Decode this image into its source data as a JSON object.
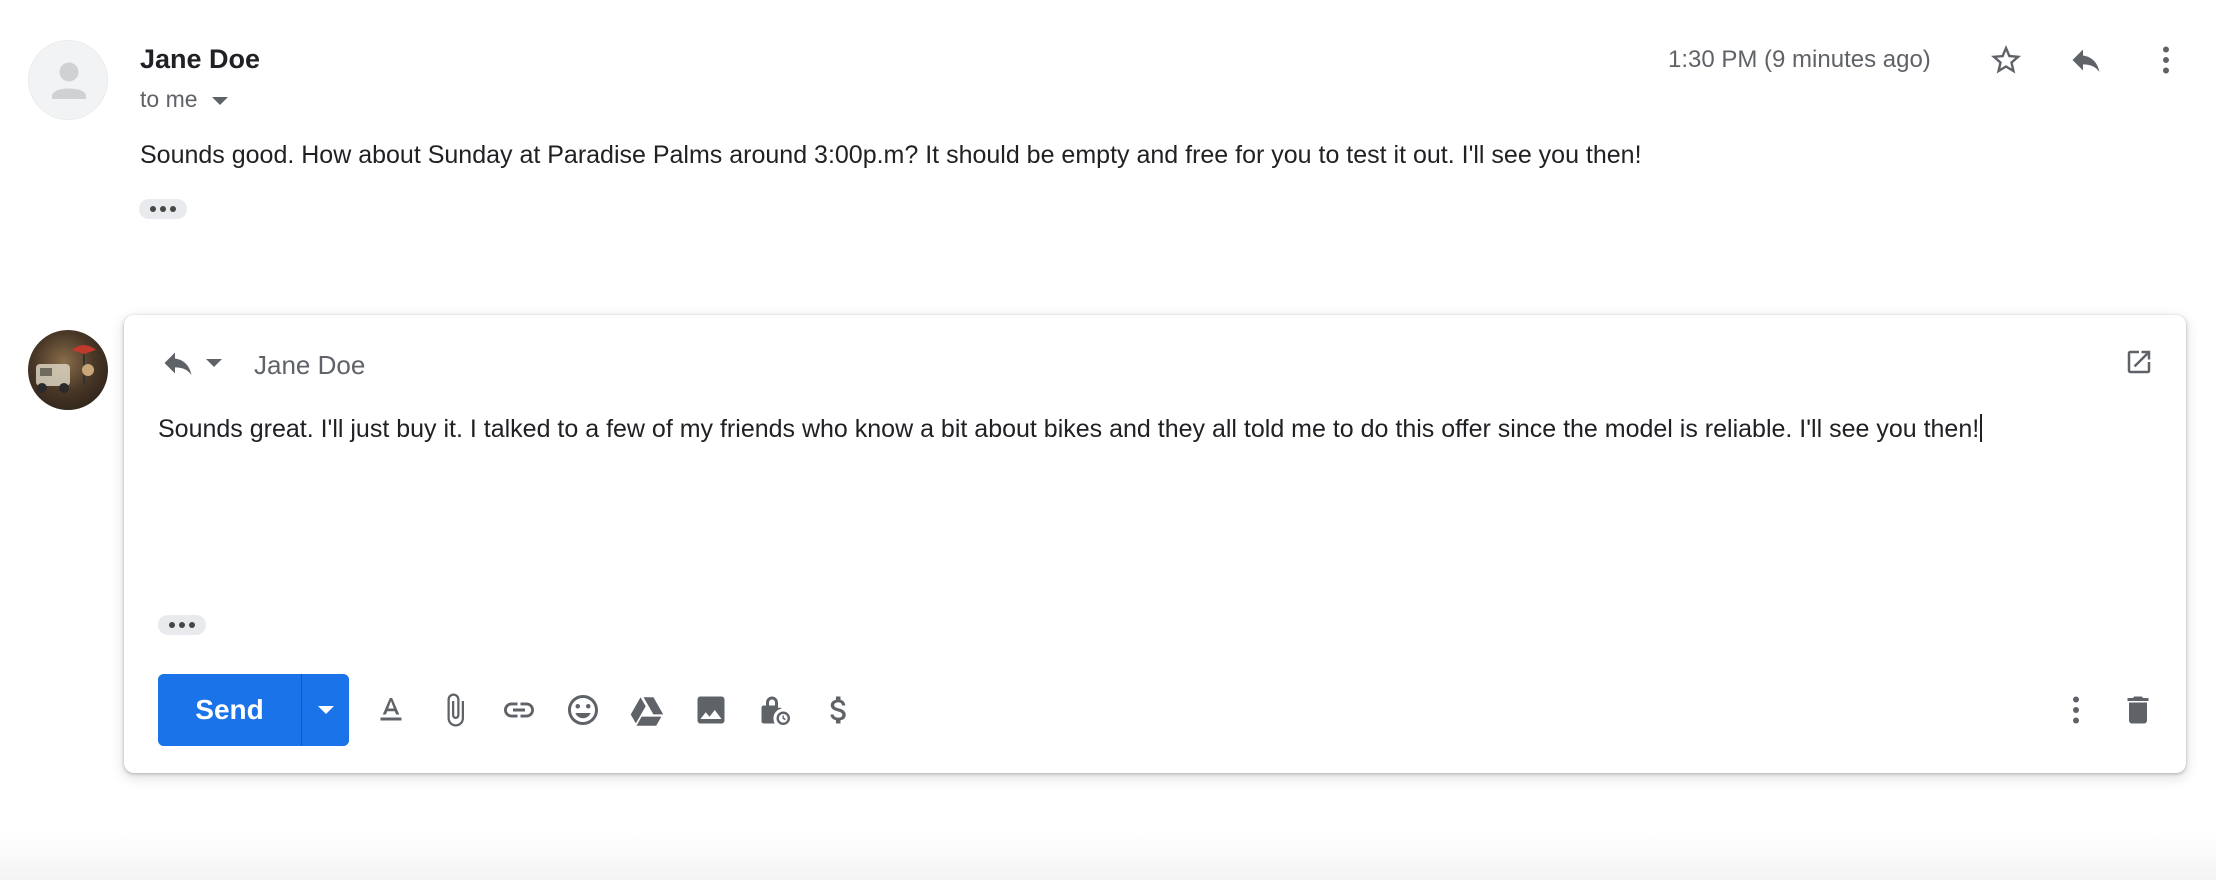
{
  "message": {
    "sender_name": "Jane Doe",
    "recipient_label": "to me",
    "timestamp": "1:30 PM (9 minutes ago)",
    "body": "Sounds good. How about Sunday at Paradise Palms around 3:00p.m? It should be empty and free for you to test it out. I'll see you then!",
    "icons": [
      "star-icon",
      "reply-icon",
      "more-vert-icon",
      "ellipsis-icon"
    ]
  },
  "reply": {
    "to": "Jane Doe",
    "body": "Sounds great. I'll just buy it. I talked to a few of my friends who know a bit about bikes and they all told me to do this offer since the model is reliable. I'll see you then!",
    "send_label": "Send",
    "toolbar_icons": [
      "format-text-icon",
      "attach-icon",
      "link-icon",
      "emoji-icon",
      "drive-icon",
      "photo-icon",
      "confidential-mode-icon",
      "dollar-icon",
      "more-vert-icon",
      "trash-icon"
    ]
  },
  "colors": {
    "accent": "#1a73e8",
    "icon_gray": "#5f6368",
    "text": "#202124"
  }
}
